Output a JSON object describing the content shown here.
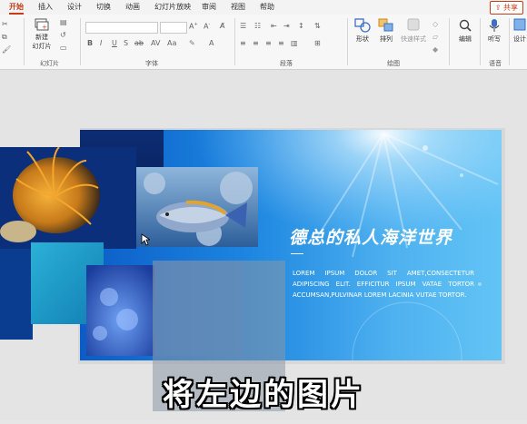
{
  "tabs": [
    "开始",
    "插入",
    "设计",
    "切换",
    "动画",
    "幻灯片放映",
    "审阅",
    "视图",
    "帮助"
  ],
  "share_label": "共享",
  "ribbon": {
    "new_slide": "新建\n幻灯片",
    "new_slide_short": "新建",
    "new_slide_line2": "幻灯片",
    "groups": {
      "slides": "幻灯片",
      "font": "字体",
      "paragraph": "段落",
      "drawing": "绘图",
      "voice": "语音"
    },
    "shape": "形状",
    "arrange": "排列",
    "quick_styles": "快速样式",
    "edit": "编辑",
    "dictate": "听写",
    "designer": "设计"
  },
  "slide": {
    "title": "德总的私人海洋世界",
    "body": "LOREM IPSUM DOLOR SIT AMET,CONSECTETUR ADIPISCING ELIT. EFFICITUR IPSUM VATAE TORTOR ACCUMSAN,PULVINAR LOREM LACINIA VUTAE TORTOR."
  },
  "caption": "将左边的图片",
  "colors": {
    "accent": "#c43e1c",
    "slide_dark": "#0b5cc7",
    "slide_light": "#62c4f5"
  }
}
